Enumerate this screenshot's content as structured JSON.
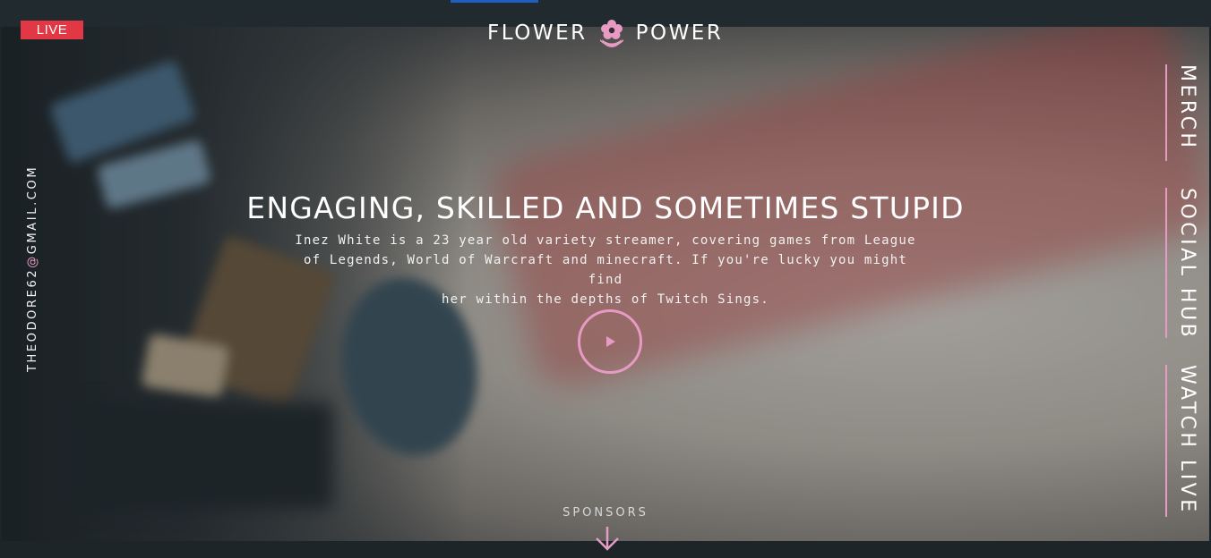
{
  "header": {
    "live_badge": "LIVE",
    "brand_left": "FLOWER",
    "brand_right": "POWER",
    "brand_icon": "flower-icon"
  },
  "sidebar_left": {
    "email_user": "THEODORE62",
    "email_at": "@",
    "email_domain": "GMAIL.COM"
  },
  "hero": {
    "headline": "ENGAGING, SKILLED AND SOMETIMES STUPID",
    "description_lines": [
      "Inez White is a 23 year old variety streamer, covering games from League",
      "of Legends, World of Warcraft and minecraft. If you're lucky you might find",
      "her within the depths of Twitch Sings."
    ],
    "play_icon": "play-icon"
  },
  "nav": {
    "items": [
      {
        "label": "MERCH"
      },
      {
        "label": "SOCIAL HUB"
      },
      {
        "label": "WATCH LIVE"
      }
    ]
  },
  "footer": {
    "sponsors_label": "SPONSORS",
    "arrow_icon": "arrow-down-icon"
  },
  "colors": {
    "accent_pink": "#e79ac3",
    "live_red": "#e23744",
    "dark_bg": "#1e2528",
    "top_accent_blue": "#1f5fbf"
  }
}
